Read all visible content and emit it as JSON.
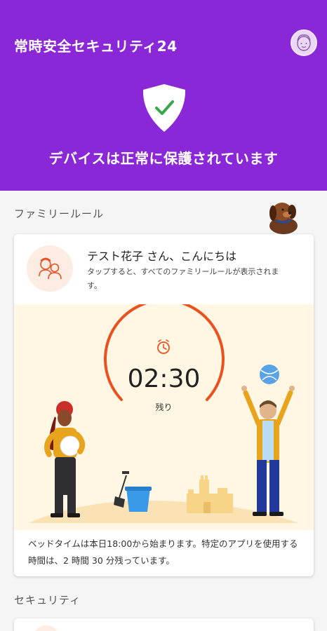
{
  "app": {
    "title": "常時安全セキュリティ24",
    "status_message": "デバイスは正常に保護されています"
  },
  "colors": {
    "brand_purple": "#8a28d8",
    "accent_orange": "#e8521f",
    "scene_background": "#fff6e4"
  },
  "icons": {
    "avatar": "child-avatar-icon",
    "shield": "shield-check-icon",
    "family": "family-icon",
    "timer": "clock-icon"
  },
  "family_section": {
    "label": "ファミリールール",
    "greeting": "テスト花子 さん、こんにちは",
    "subtitle": "タップすると、すべてのファミリールールが表示されます。",
    "timer": {
      "value": "02:30",
      "label": "残り"
    },
    "description": "ベッドタイムは本日18:00から始まります。特定のアプリを使用する時間は、2 時間 30 分残っています。"
  },
  "security_section": {
    "label": "セキュリティ"
  }
}
